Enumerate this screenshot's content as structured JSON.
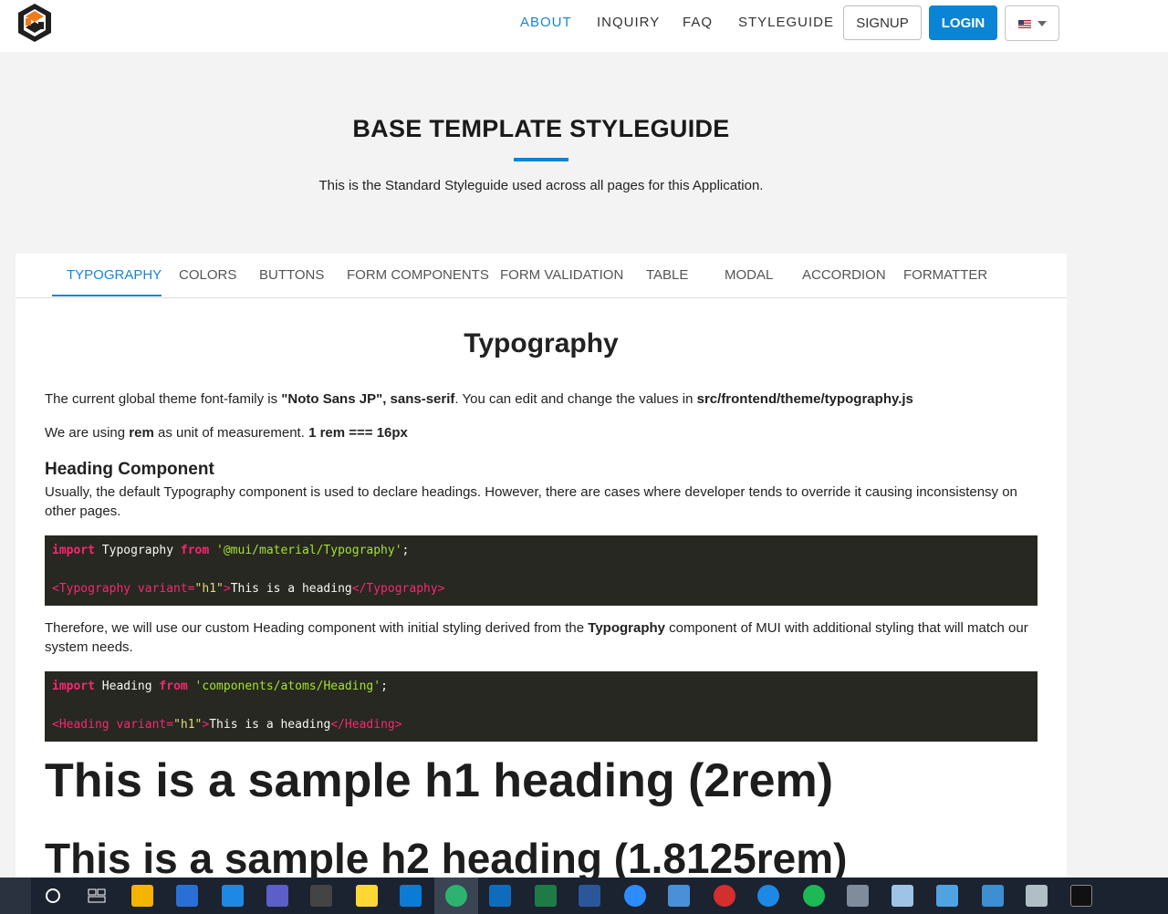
{
  "header": {
    "nav": [
      {
        "label": "ABOUT",
        "active": true
      },
      {
        "label": "INQUIRY",
        "active": false
      },
      {
        "label": "FAQ",
        "active": false
      },
      {
        "label": "STYLEGUIDE",
        "active": false
      }
    ],
    "signup_label": "SIGNUP",
    "login_label": "LOGIN",
    "language_icon": "us-flag-icon"
  },
  "hero": {
    "title": "BASE TEMPLATE STYLEGUIDE",
    "subtitle": "This is the Standard Styleguide used across all pages for this Application."
  },
  "tabs": [
    {
      "label": "TYPOGRAPHY",
      "active": true
    },
    {
      "label": "COLORS",
      "active": false
    },
    {
      "label": "BUTTONS",
      "active": false
    },
    {
      "label": "FORM COMPONENTS",
      "active": false
    },
    {
      "label": "FORM VALIDATION",
      "active": false
    },
    {
      "label": "TABLE",
      "active": false
    },
    {
      "label": "MODAL",
      "active": false
    },
    {
      "label": "ACCORDION",
      "active": false
    },
    {
      "label": "FORMATTER",
      "active": false
    }
  ],
  "content": {
    "section_title": "Typography",
    "font_line": {
      "pre": "The current global theme font-family is ",
      "font": "\"Noto Sans JP\", sans-serif",
      "mid": ". You can edit and change the values in ",
      "path": "src/frontend/theme/typography.js"
    },
    "unit_line": {
      "pre": "We are using ",
      "unit": "rem",
      "mid": " as unit of measurement. ",
      "eq": "1 rem === 16px"
    },
    "heading_component_title": "Heading Component",
    "heading_component_desc": "Usually, the default Typography component is used to declare headings. However, there are cases where developer tends to override it causing inconsistensy on other pages.",
    "code1": {
      "line1_kw": "import",
      "line1_name": " Typography ",
      "line1_from": "from",
      "line1_str": " '@mui/material/Typography'",
      "line1_end": ";",
      "line2_open": "<Typography",
      "line2_attr": " variant=",
      "line2_val": "\"h1\"",
      "line2_gt": ">",
      "line2_text": "This is a heading",
      "line2_close": "</Typography>"
    },
    "therefore_line": {
      "pre": "Therefore, we will use our custom Heading component with initial styling derived from the ",
      "bold": "Typography",
      "post": " component of MUI with additional styling that will match our system needs."
    },
    "code2": {
      "line1_kw": "import",
      "line1_name": " Heading ",
      "line1_from": "from",
      "line1_str": " 'components/atoms/Heading'",
      "line1_end": ";",
      "line2_open": "<Heading",
      "line2_attr": " variant=",
      "line2_val": "\"h1\"",
      "line2_gt": ">",
      "line2_text": "This is a heading",
      "line2_close": "</Heading>"
    },
    "sample_h1": "This is a sample h1 heading (2rem)",
    "sample_h2": "This is a sample h2 heading (1.8125rem)"
  },
  "taskbar": {
    "icons": [
      "search-icon",
      "task-view-icon",
      "file-explorer-icon",
      "store-icon",
      "mail-icon",
      "teams-icon",
      "terminal-icon",
      "sticky-notes-icon",
      "vscode-icon",
      "edge-icon",
      "outlook-icon",
      "excel-icon",
      "word-icon",
      "zoom-icon",
      "remote-desktop-icon",
      "snip-icon",
      "onedrive-icon",
      "spotify-icon",
      "calculator-icon",
      "notepad-icon",
      "settings-icon",
      "network-icon",
      "device-icon",
      "cmd-icon"
    ]
  }
}
